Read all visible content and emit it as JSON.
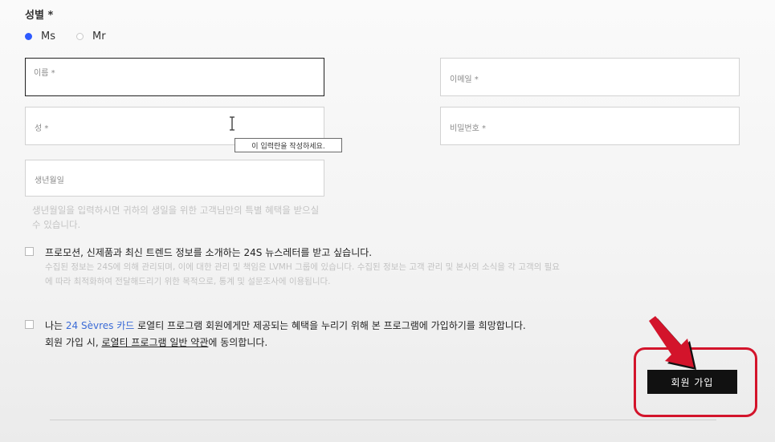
{
  "gender": {
    "label": "성별 *",
    "options": [
      {
        "label": "Ms",
        "selected": true
      },
      {
        "label": "Mr",
        "selected": false
      }
    ]
  },
  "fields": {
    "first_name": {
      "label": "이름 *",
      "value": ""
    },
    "email": {
      "label": "이메일 *",
      "value": ""
    },
    "last_name": {
      "label": "성 *",
      "value": ""
    },
    "password": {
      "label": "비밀번호 *",
      "value": ""
    },
    "birthday": {
      "label": "생년월일",
      "value": ""
    }
  },
  "tooltip": "이 입력란을 작성하세요.",
  "birthday_helper": "생년월일을 입력하시면 귀하의 생일을 위한 고객님만의 특별 혜택을 받으실 수 있습니다.",
  "newsletter": {
    "checked": false,
    "label": "프로모션, 신제품과 최신 트렌드 정보를 소개하는 24S 뉴스레터를 받고 싶습니다.",
    "desc_line1": "수집된 정보는 24S에 의해 관리되며, 이에 대한 관리 및 책임은 LVMH 그룹에 있습니다. 수집된 정보는 고객 관리 및 본사의 소식을 각 고객의 필요",
    "desc_line2": "에 따라 최적화하여 전달해드리기 위한 목적으로, 통계 및 설문조사에 이용됩니다."
  },
  "loyalty": {
    "checked": false,
    "prefix": "나는 ",
    "card_link": "24 Sèvres 카드",
    "suffix": " 로열티 프로그램 회원에게만 제공되는 혜택을 누리기 위해 본 프로그램에 가입하기를 희망합니다.",
    "line2_prefix": "회원 가입 시, ",
    "terms_link": "로열티 프로그램 일반 약관",
    "line2_suffix": "에 동의합니다."
  },
  "signup_button": "회원 가입",
  "colors": {
    "accent": "#2f5bff",
    "highlight": "#d3142b",
    "button_bg": "#111111",
    "link": "#3b6bd6"
  }
}
